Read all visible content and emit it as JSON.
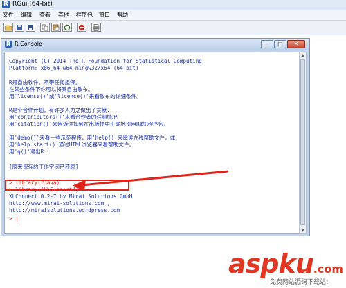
{
  "window": {
    "title": "RGui (64-bit)",
    "icon": "r-logo-icon"
  },
  "menu": [
    "文件",
    "编辑",
    "查看",
    "其他",
    "程序包",
    "窗口",
    "帮助"
  ],
  "toolbar": {
    "buttons": [
      "open-script-icon",
      "load-workspace-icon",
      "save-workspace-icon",
      "copy-icon",
      "paste-icon",
      "copy-paste-icon",
      "stop-icon",
      "print-icon"
    ]
  },
  "console": {
    "title": "R Console",
    "lines": [
      "Copyright (C) 2014 The R Foundation for Statistical Computing",
      "Platform: x86_64-w64-mingw32/x64 (64-bit)",
      "",
      "R是自由软件，不带任何担保。",
      "在某些条件下你可以将其自由散布。",
      "用'license()'或'licence()'来看散布的详细条件。",
      "",
      "R是个合作计划，有许多人为之做出了贡献.",
      "用'contributors()'来看合作者的详细情况",
      "用'citation()'会告诉你如何在出版物中正确地引用R或R程序包。",
      "",
      "用'demo()'来看一些示范程序，用'help()'来阅读在线帮助文件，或",
      "用'help.start()'通过HTML浏览器来看帮助文件。",
      "用'q()'退出R.",
      "",
      "[原来保存的工作空间已还原]",
      "",
      "> library(rJava)",
      "> library(\"XLConnect\")",
      "XLConnect 0.2-7 by Mirai Solutions GmbH",
      "http://www.mirai-solutions.com ,",
      "http://miraisolutions.wordpress.com",
      "> |"
    ]
  },
  "annotation": {
    "color": "#e0241a"
  },
  "watermark": {
    "main": "aspku",
    "tld": ".com",
    "sub": "免费网站源码下载站!"
  }
}
